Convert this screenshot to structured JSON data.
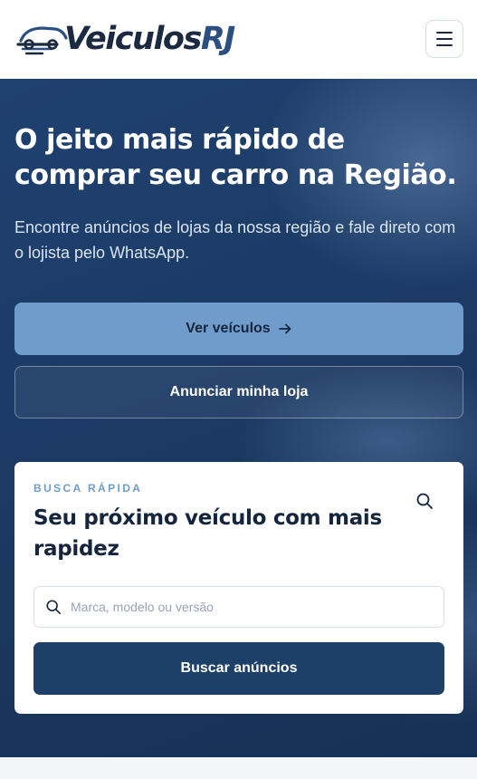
{
  "header": {
    "brand_main": "Veiculos",
    "brand_accent": "RJ",
    "menu_icon": "hamburger-icon"
  },
  "hero": {
    "title": "O jeito mais rápido de comprar seu carro na Região.",
    "subtitle": "Encontre anúncios de lojas da nossa região e fale direto com o lojista pelo WhatsApp.",
    "primary_button": "Ver veículos",
    "primary_button_icon": "arrow-right-icon",
    "secondary_button": "Anunciar minha loja"
  },
  "quick_search": {
    "eyebrow": "BUSCA RÁPIDA",
    "title": "Seu próximo veículo com mais rapidez",
    "input_placeholder": "Marca, modelo ou versão",
    "input_value": "",
    "submit_label": "Buscar anúncios",
    "icon": "search-icon"
  },
  "colors": {
    "brand_dark": "#1b2a40",
    "brand_blue": "#2a4f80",
    "hero_bg": "#1c3b66",
    "primary_button": "#6f9ccb",
    "search_button": "#1c4068"
  }
}
